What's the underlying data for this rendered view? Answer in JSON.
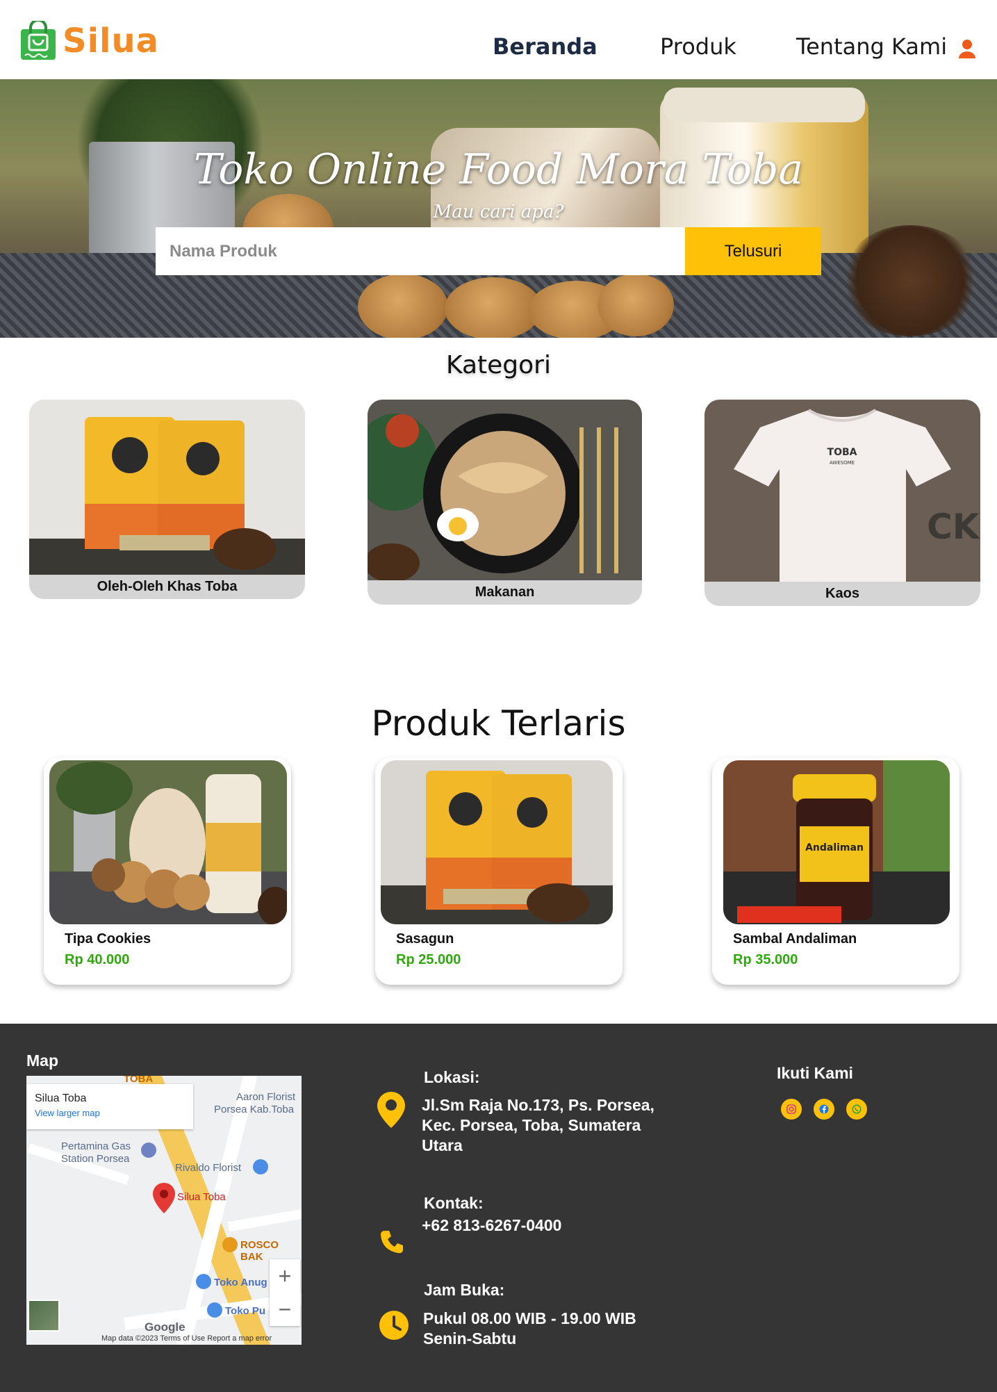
{
  "brand": {
    "name": "Silua",
    "color": "#f28c28"
  },
  "nav": {
    "home": "Beranda",
    "products": "Produk",
    "about": "Tentang Kami",
    "user_icon": "user-icon"
  },
  "hero": {
    "title": "Toko Online Food Mora Toba",
    "subtitle": "Mau cari apa?",
    "search_placeholder": "Nama Produk",
    "search_value": "",
    "search_button": "Telusuri"
  },
  "categories": {
    "title": "Kategori",
    "items": [
      {
        "label": "Oleh-Oleh Khas Toba"
      },
      {
        "label": "Makanan"
      },
      {
        "label": "Kaos"
      }
    ]
  },
  "products": {
    "title": "Produk Terlaris",
    "items": [
      {
        "name": "Tipa Cookies",
        "price": "Rp 40.000"
      },
      {
        "name": "Sasagun",
        "price": "Rp 25.000"
      },
      {
        "name": "Sambal Andaliman",
        "price": "Rp 35.000"
      }
    ],
    "price_color": "#2fa80d"
  },
  "footer": {
    "map_title": "Map",
    "map": {
      "place_name": "Silua Toba",
      "larger_map": "View larger map",
      "labels": {
        "aaron": "Aaron Florist",
        "porsea": "Porsea Kab.Toba",
        "pertamina1": "Pertamina Gas",
        "pertamina2": "Station Porsea",
        "rivaldo": "Rivaldo Florist",
        "silua": "Silua Toba",
        "rosco": "ROSCO BAK",
        "anug": "Toko Anug",
        "pu": "Toko Pu",
        "toba": "TOBA"
      },
      "zoom_in": "+",
      "zoom_out": "−",
      "google": "Google",
      "attribution": "Map data ©2023    Terms of Use    Report a map error"
    },
    "location_title": "Lokasi:",
    "location_lines": [
      "Jl.Sm Raja No.173, Ps. Porsea,",
      "Kec. Porsea, Toba, Sumatera",
      "Utara"
    ],
    "contact_title": "Kontak:",
    "contact_value": "+62 813-6267-0400",
    "hours_title": "Jam Buka:",
    "hours_lines": [
      "Pukul 08.00 WIB - 19.00 WIB",
      "Senin-Sabtu"
    ],
    "follow_title": "Ikuti Kami",
    "accent": "#ffc107",
    "background": "#353535"
  }
}
